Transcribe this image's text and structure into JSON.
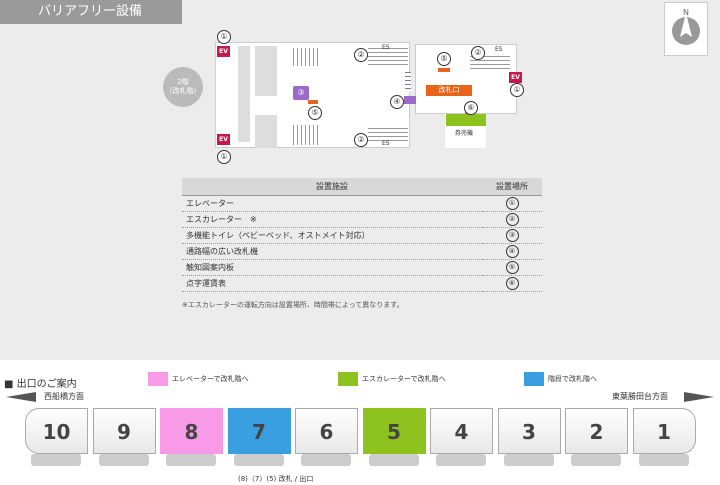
{
  "header": {
    "title": "バリアフリー設備"
  },
  "floorplan": {
    "floor_label": "2階",
    "floor_sub": "(改札階)",
    "ev_label": "EV",
    "es_label": "ES",
    "gate_label": "改札口",
    "ticket_label": "券売機",
    "markers": {
      "m1": "①",
      "m2": "②",
      "m3": "③",
      "m4": "④",
      "m5": "⑤",
      "m6": "⑥"
    }
  },
  "table": {
    "col_facility": "設置施設",
    "col_location": "設置場所",
    "rows": [
      {
        "facility": "エレベーター",
        "location": "①"
      },
      {
        "facility": "エスカレーター　※",
        "location": "②"
      },
      {
        "facility": "多機能トイレ（ベビーベッド、オストメイト対応）",
        "location": "③"
      },
      {
        "facility": "通路幅の広い改札機",
        "location": "④"
      },
      {
        "facility": "触知図案内板",
        "location": "⑤"
      },
      {
        "facility": "点字運賃表",
        "location": "⑥"
      }
    ],
    "note": "※エスカレーターの運転方向は設置場所、時間帯によって異なります。"
  },
  "exits": {
    "title": "■ 出口のご案内",
    "legend": [
      {
        "label": "エレベーターで改札階へ",
        "color": "#f99ae8"
      },
      {
        "label": "エスカレーターで改札階へ",
        "color": "#8dc21f"
      },
      {
        "label": "階段で改札階へ",
        "color": "#3a9fe0"
      }
    ],
    "direction_left": "西船橋方面",
    "direction_right": "東葉勝田台方面",
    "cars": [
      "10",
      "9",
      "8",
      "7",
      "6",
      "5",
      "4",
      "3",
      "2",
      "1"
    ],
    "car_colors": [
      "",
      "",
      "#f99ae8",
      "#3a9fe0",
      "",
      "#8dc21f",
      "",
      "",
      "",
      ""
    ],
    "exit_label": "(8)（7）(5) 改札 / 出口"
  }
}
